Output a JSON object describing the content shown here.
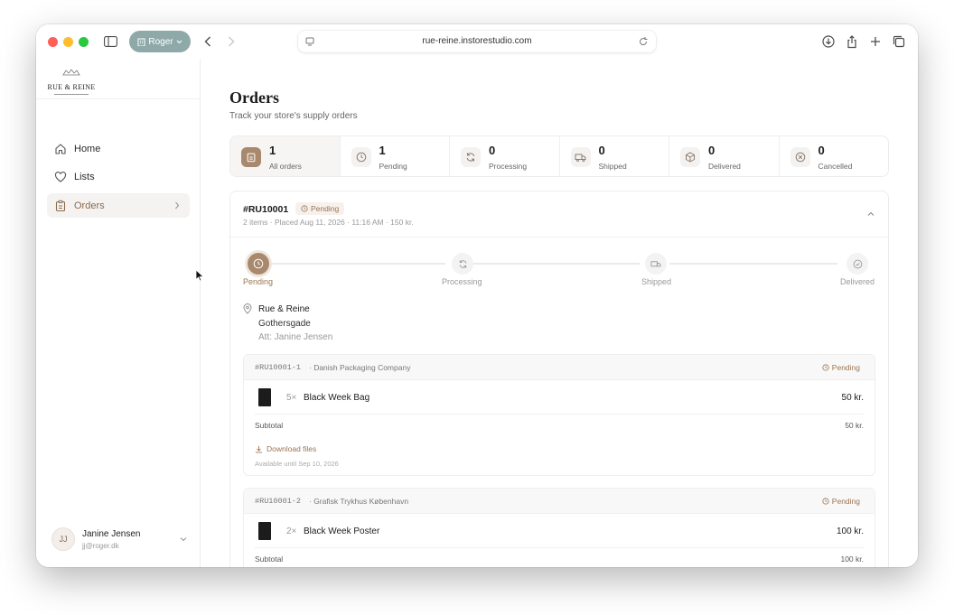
{
  "browser": {
    "profile_label": "Roger",
    "url": "rue-reine.instorestudio.com"
  },
  "brand": {
    "name": "RUE & REINE"
  },
  "sidebar": {
    "items": [
      {
        "label": "Home",
        "icon": "home-icon"
      },
      {
        "label": "Lists",
        "icon": "heart-icon"
      },
      {
        "label": "Orders",
        "icon": "clipboard-icon",
        "active": true
      }
    ],
    "user": {
      "initials": "JJ",
      "name": "Janine Jensen",
      "email": "jj@roger.dk"
    }
  },
  "page": {
    "title": "Orders",
    "subtitle": "Track your store's supply orders"
  },
  "stats": [
    {
      "value": "1",
      "label": "All orders",
      "icon": "clipboard-icon",
      "active": true
    },
    {
      "value": "1",
      "label": "Pending",
      "icon": "clock-icon"
    },
    {
      "value": "0",
      "label": "Processing",
      "icon": "refresh-icon"
    },
    {
      "value": "0",
      "label": "Shipped",
      "icon": "truck-icon"
    },
    {
      "value": "0",
      "label": "Delivered",
      "icon": "box-icon"
    },
    {
      "value": "0",
      "label": "Cancelled",
      "icon": "x-circle-icon"
    }
  ],
  "order": {
    "id": "#RU10001",
    "status": "Pending",
    "meta": "2 items · Placed Aug 11, 2026 · 11:16 AM · 150 kr.",
    "steps": [
      {
        "label": "Pending",
        "done": true
      },
      {
        "label": "Processing",
        "done": false
      },
      {
        "label": "Shipped",
        "done": false
      },
      {
        "label": "Delivered",
        "done": false
      }
    ],
    "address": {
      "name": "Rue & Reine",
      "street": "Gothersgade",
      "att": "Att: Janine Jensen"
    },
    "sub_orders": [
      {
        "id": "#RU10001-1",
        "vendor": "· Danish Packaging Company",
        "status": "Pending",
        "item": {
          "qty": "5×",
          "name": "Black Week Bag",
          "price": "50 kr."
        },
        "subtotal_label": "Subtotal",
        "subtotal": "50 kr.",
        "download_label": "Download files",
        "download_note": "Available until Sep 10, 2026"
      },
      {
        "id": "#RU10001-2",
        "vendor": "· Grafisk Trykhus København",
        "status": "Pending",
        "item": {
          "qty": "2×",
          "name": "Black Week Poster",
          "price": "100 kr."
        },
        "subtotal_label": "Subtotal",
        "subtotal": "100 kr."
      }
    ]
  },
  "colors": {
    "accent": "#a8896d",
    "accent_text": "#9c7451",
    "profile_pill": "#8fa9a9"
  }
}
